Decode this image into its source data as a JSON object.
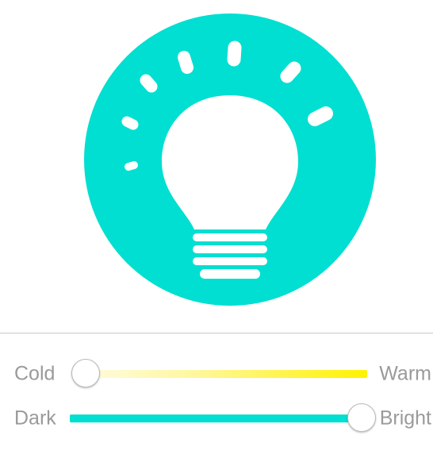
{
  "colors": {
    "accent": "#00dfd1",
    "warm": "#fff200",
    "cold": "#fffbe0",
    "label": "#9a9a9a"
  },
  "icon": "light-bulb-icon",
  "temperature_slider": {
    "left_label": "Cold",
    "right_label": "Warm",
    "value": 0
  },
  "brightness_slider": {
    "left_label": "Dark",
    "right_label": "Bright",
    "value": 1
  }
}
